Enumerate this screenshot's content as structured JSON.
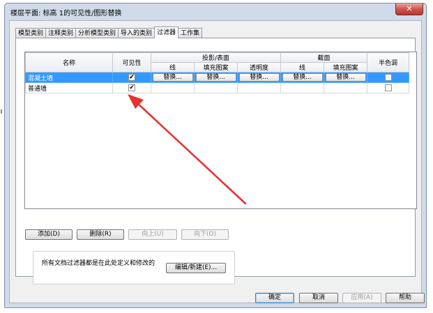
{
  "window": {
    "title": "楼层平面: 标高 1的可见性/图形替换",
    "close_glyph": "✕"
  },
  "tabs": [
    {
      "label": "模型类别",
      "active": false
    },
    {
      "label": "注释类别",
      "active": false
    },
    {
      "label": "分析模型类别",
      "active": false
    },
    {
      "label": "导入的类别",
      "active": false
    },
    {
      "label": "过滤器",
      "active": true
    },
    {
      "label": "工作集",
      "active": false
    }
  ],
  "grid": {
    "headers": {
      "name": "名称",
      "visibility": "可见性",
      "projection_group": "投影/表面",
      "cut_group": "截面",
      "halftone": "半色调",
      "proj_lines": "线",
      "proj_patterns": "填充图案",
      "proj_transparency": "透明度",
      "cut_lines": "线",
      "cut_patterns": "填充图案"
    },
    "override_label": "替换...",
    "rows": [
      {
        "name": "混凝土墙",
        "visible": "✔",
        "halftone": "",
        "selected": true
      },
      {
        "name": "普通墙",
        "visible": "✔",
        "halftone": "",
        "selected": false
      }
    ]
  },
  "buttons": {
    "add": "添加(D)",
    "delete": "删除(R)",
    "up": "向上(U)",
    "down": "向下(O)",
    "edit_new": "编辑/新建(E)...",
    "ok": "确定",
    "cancel": "取消",
    "apply": "应用(A)",
    "help": "帮助"
  },
  "info": {
    "text": "所有文档过滤器都是在此处定义和修改的"
  },
  "colors": {
    "selection": "#3399ff",
    "annotation_arrow": "#e8322f",
    "frame": "#cfdbe9"
  }
}
